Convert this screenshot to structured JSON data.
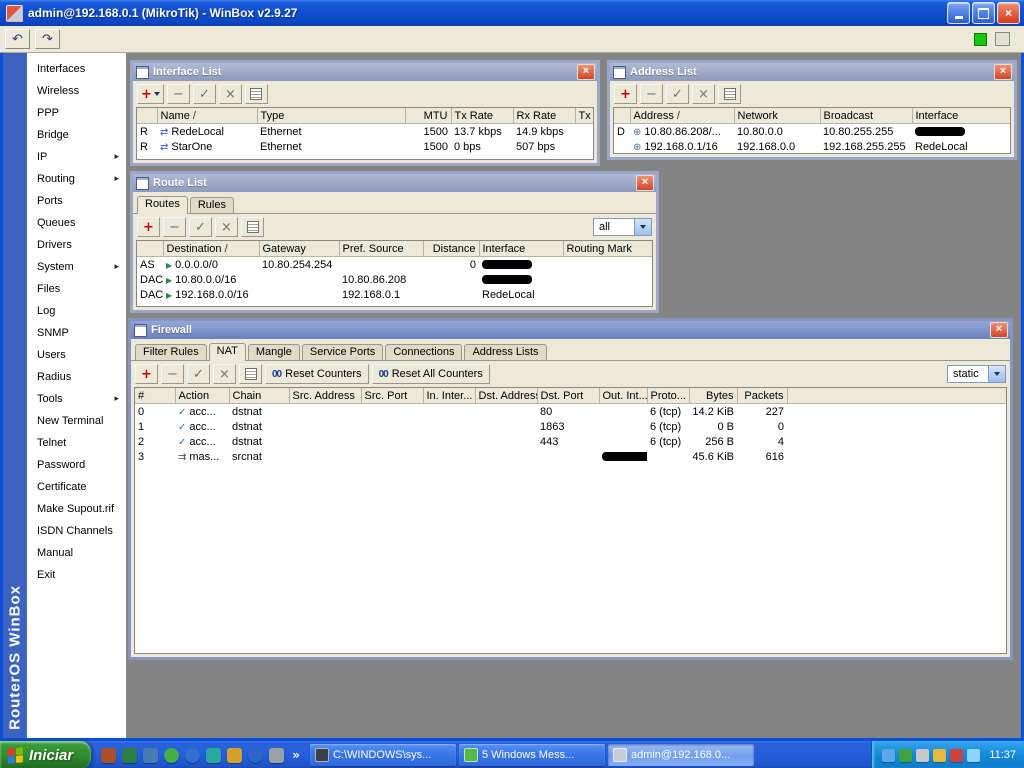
{
  "window": {
    "title": "admin@192.168.0.1 (MikroTik) - WinBox v2.9.27",
    "close_icon": "×"
  },
  "toolbar": {
    "undo_icon": "↶",
    "redo_icon": "↷"
  },
  "brand": "RouterOS WinBox",
  "icons": {
    "add": "+",
    "remove": "−",
    "enable": "✓",
    "disable": "×",
    "submenu_arrow": "▸",
    "overflow_chevron": "»",
    "counter": "00"
  },
  "sidebar": {
    "items": [
      {
        "label": "Interfaces",
        "submenu": false
      },
      {
        "label": "Wireless",
        "submenu": false
      },
      {
        "label": "PPP",
        "submenu": false
      },
      {
        "label": "Bridge",
        "submenu": false
      },
      {
        "label": "IP",
        "submenu": true
      },
      {
        "label": "Routing",
        "submenu": true
      },
      {
        "label": "Ports",
        "submenu": false
      },
      {
        "label": "Queues",
        "submenu": false
      },
      {
        "label": "Drivers",
        "submenu": false
      },
      {
        "label": "System",
        "submenu": true
      },
      {
        "label": "Files",
        "submenu": false
      },
      {
        "label": "Log",
        "submenu": false
      },
      {
        "label": "SNMP",
        "submenu": false
      },
      {
        "label": "Users",
        "submenu": false
      },
      {
        "label": "Radius",
        "submenu": false
      },
      {
        "label": "Tools",
        "submenu": true
      },
      {
        "label": "New Terminal",
        "submenu": false
      },
      {
        "label": "Telnet",
        "submenu": false
      },
      {
        "label": "Password",
        "submenu": false
      },
      {
        "label": "Certificate",
        "submenu": false
      },
      {
        "label": "Make Supout.rif",
        "submenu": false
      },
      {
        "label": "ISDN Channels",
        "submenu": false
      },
      {
        "label": "Manual",
        "submenu": false
      },
      {
        "label": "Exit",
        "submenu": false
      }
    ]
  },
  "windows": {
    "interface_list": {
      "title": "Interface List",
      "columns": [
        "",
        "Name",
        "Type",
        "MTU",
        "Tx Rate",
        "Rx Rate",
        "Tx P"
      ],
      "rows": [
        [
          "R",
          {
            "t": "RedeLocal",
            "icon": "ethernet"
          },
          "Ethernet",
          "1500",
          "13.7 kbps",
          "14.9 kbps",
          ""
        ],
        [
          "R",
          {
            "t": "StarOne",
            "icon": "ethernet"
          },
          "Ethernet",
          "1500",
          "0 bps",
          "507 bps",
          ""
        ]
      ]
    },
    "address_list": {
      "title": "Address List",
      "columns": [
        "",
        "Address",
        "Network",
        "Broadcast",
        "Interface"
      ],
      "rows": [
        [
          "D",
          {
            "t": "10.80.86.208/...",
            "icon": "address"
          },
          "10.80.0.0",
          "10.80.255.255",
          {
            "redacted": true
          }
        ],
        [
          "",
          {
            "t": "192.168.0.1/16",
            "icon": "address"
          },
          "192.168.0.0",
          "192.168.255.255",
          "RedeLocal"
        ]
      ]
    },
    "route_list": {
      "title": "Route List",
      "tabs": [
        "Routes",
        "Rules"
      ],
      "active_tab": "Routes",
      "filter_value": "all",
      "columns": [
        "",
        "Destination",
        "Gateway",
        "Pref. Source",
        "Distance",
        "Interface",
        "Routing Mark"
      ],
      "rows": [
        [
          "AS",
          {
            "t": "0.0.0.0/0",
            "icon": "route"
          },
          "10.80.254.254",
          "",
          "0",
          {
            "redacted": true
          },
          ""
        ],
        [
          "DAC",
          {
            "t": "10.80.0.0/16",
            "icon": "route"
          },
          "",
          "10.80.86.208",
          "",
          {
            "redacted": true
          },
          ""
        ],
        [
          "DAC",
          {
            "t": "192.168.0.0/16",
            "icon": "route"
          },
          "",
          "192.168.0.1",
          "",
          "RedeLocal",
          ""
        ]
      ]
    },
    "firewall": {
      "title": "Firewall",
      "tabs": [
        "Filter Rules",
        "NAT",
        "Mangle",
        "Service Ports",
        "Connections",
        "Address Lists"
      ],
      "active_tab": "NAT",
      "reset_counters": "Reset Counters",
      "reset_all_counters": "Reset All Counters",
      "filter_value": "static",
      "columns": [
        "#",
        "Action",
        "Chain",
        "Src. Address",
        "Src. Port",
        "In. Inter...",
        "Dst. Address",
        "Dst. Port",
        "Out. Int...",
        "Proto...",
        "Bytes",
        "Packets",
        ""
      ],
      "rows": [
        [
          "0",
          {
            "t": "acc...",
            "icon": "accept"
          },
          "dstnat",
          "",
          "",
          "",
          "",
          "80",
          "",
          "6 (tcp)",
          "14.2 KiB",
          "227",
          ""
        ],
        [
          "1",
          {
            "t": "acc...",
            "icon": "accept"
          },
          "dstnat",
          "",
          "",
          "",
          "",
          "1863",
          "",
          "6 (tcp)",
          "0 B",
          "0",
          ""
        ],
        [
          "2",
          {
            "t": "acc...",
            "icon": "accept"
          },
          "dstnat",
          "",
          "",
          "",
          "",
          "443",
          "",
          "6 (tcp)",
          "256 B",
          "4",
          ""
        ],
        [
          "3",
          {
            "t": "mas...",
            "icon": "masquerade"
          },
          "srcnat",
          "",
          "",
          "",
          "",
          "",
          {
            "redacted": true
          },
          "",
          "45.6 KiB",
          "616",
          ""
        ]
      ]
    }
  },
  "taskbar": {
    "start_label": "Iniciar",
    "quicklaunch": [
      {
        "name": "quicklaunch-icon-1",
        "color": "#a8502c",
        "round": false
      },
      {
        "name": "quicklaunch-icon-2",
        "color": "#2e7d46",
        "round": false
      },
      {
        "name": "quicklaunch-icon-3",
        "color": "#4a7ab5",
        "round": false
      },
      {
        "name": "quicklaunch-icon-4",
        "color": "#45b04a",
        "round": true
      },
      {
        "name": "quicklaunch-icon-5",
        "color": "#2f6fd0",
        "round": true
      },
      {
        "name": "quicklaunch-icon-6",
        "color": "#2aa8a0",
        "round": false
      },
      {
        "name": "quicklaunch-icon-7",
        "color": "#d2a22c",
        "round": false
      },
      {
        "name": "quicklaunch-icon-8",
        "color": "#2a66c8",
        "round": true
      },
      {
        "name": "quicklaunch-icon-9",
        "color": "#9aa0a8",
        "round": false
      }
    ],
    "tasks": [
      {
        "label": "C:\\WINDOWS\\sys...",
        "icon_color": "#3a3f4a",
        "active": false
      },
      {
        "label": "5 Windows Mess...",
        "icon_color": "#57b847",
        "active": false
      },
      {
        "label": "admin@192.168.0...",
        "icon_color": "#c8ccd4",
        "active": true
      }
    ],
    "tray_icons": [
      {
        "name": "tray-icon-1",
        "color": "#5aa8e8"
      },
      {
        "name": "tray-icon-2",
        "color": "#3fa33f"
      },
      {
        "name": "tray-icon-3",
        "color": "#c8c8c8"
      },
      {
        "name": "tray-icon-4",
        "color": "#e8b93c"
      },
      {
        "name": "tray-icon-5",
        "color": "#d04040"
      },
      {
        "name": "tray-icon-6",
        "color": "#8fd3ff"
      }
    ],
    "clock": "11:37"
  }
}
